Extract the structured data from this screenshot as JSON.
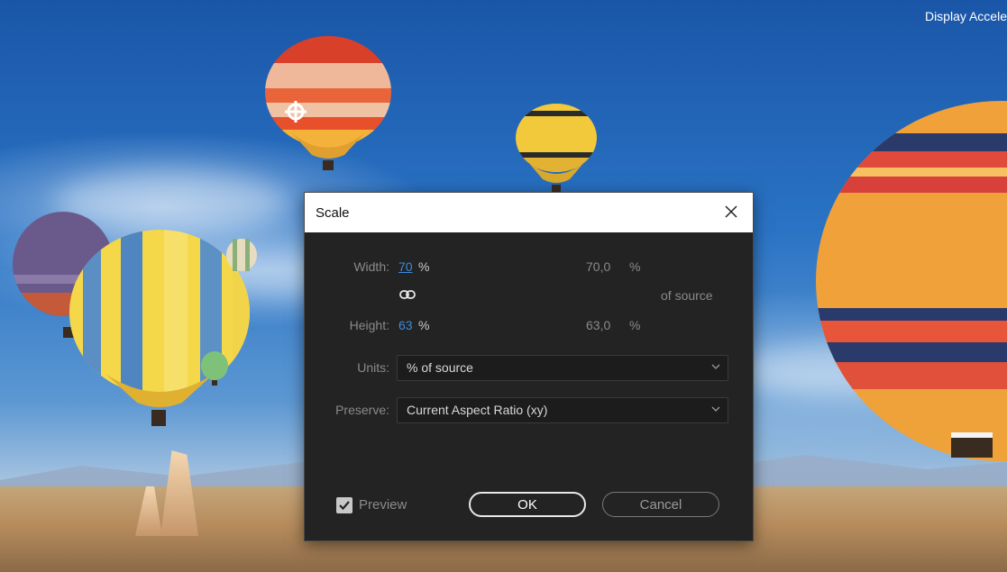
{
  "background": {
    "overlay_text": "Display Accele"
  },
  "dialog": {
    "title": "Scale",
    "close_icon": "close-icon",
    "width_label": "Width:",
    "width_value": "70",
    "width_unit": "%",
    "width_readout": "70,0",
    "width_readout_unit": "%",
    "link_icon": "link-icon",
    "of_source": "of source",
    "height_label": "Height:",
    "height_value": "63",
    "height_unit": "%",
    "height_readout": "63,0",
    "height_readout_unit": "%",
    "units_label": "Units:",
    "units_value": "% of source",
    "preserve_label": "Preserve:",
    "preserve_value": "Current Aspect Ratio (xy)",
    "preview_label": "Preview",
    "preview_checked": true,
    "ok_label": "OK",
    "cancel_label": "Cancel"
  },
  "colors": {
    "accent_link": "#3c8be0",
    "dialog_bg": "#232323",
    "titlebar_bg": "#ffffff"
  }
}
